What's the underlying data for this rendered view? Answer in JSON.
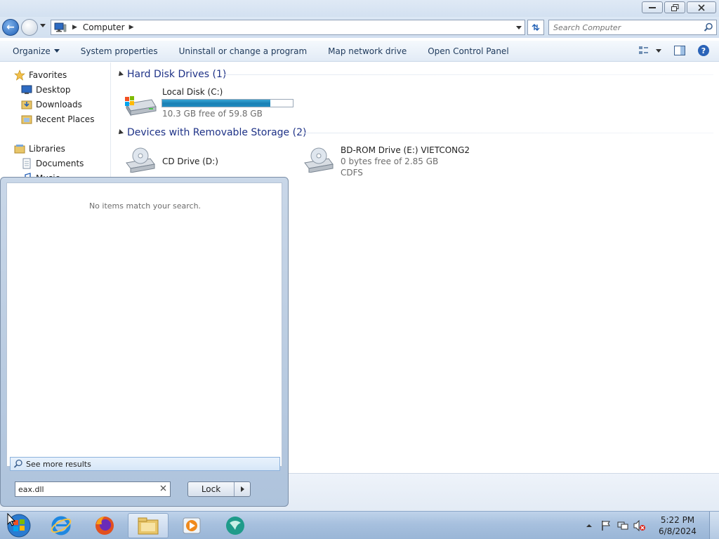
{
  "window": {
    "address": {
      "path_item": "Computer"
    },
    "search": {
      "placeholder": "Search Computer"
    },
    "controls": {
      "minimize": "minimize",
      "restore": "restore",
      "close": "close"
    }
  },
  "toolbar": {
    "organize_label": "Organize",
    "system_properties_label": "System properties",
    "uninstall_label": "Uninstall or change a program",
    "map_drive_label": "Map network drive",
    "control_panel_label": "Open Control Panel"
  },
  "navpane": {
    "favorites_label": "Favorites",
    "desktop_label": "Desktop",
    "downloads_label": "Downloads",
    "recent_places_label": "Recent Places",
    "libraries_label": "Libraries",
    "documents_label": "Documents",
    "music_label": "Music"
  },
  "content": {
    "hard_disk_group": "Hard Disk Drives (1)",
    "local_disk": {
      "name": "Local Disk (C:)",
      "free_text": "10.3 GB free of 59.8 GB",
      "used_fraction": 0.83
    },
    "removable_group": "Devices with Removable Storage (2)",
    "cd_drive": {
      "name": "CD Drive (D:)"
    },
    "bd_drive": {
      "name": "BD-ROM Drive (E:) VIETCONG2",
      "free_text": "0 bytes free of 2.85 GB",
      "filesystem": "CDFS"
    }
  },
  "startmenu": {
    "no_results": "No items match your search.",
    "see_more": "See more results",
    "search_value": "eax.dll",
    "lock_label": "Lock"
  },
  "taskbar": {
    "apps": [
      "start-button",
      "internet-explorer",
      "firefox",
      "windows-explorer",
      "media-player",
      "app"
    ],
    "clock_time": "5:22 PM",
    "clock_date": "6/8/2024"
  },
  "colors": {
    "group_heading": "#1e3287",
    "usage_fill": "#1a7fb3",
    "taskbar": "#a7c0de",
    "toolbar_text": "#1e395b"
  }
}
